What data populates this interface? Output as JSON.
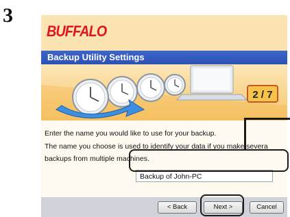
{
  "step_number": "3",
  "logo_text": "BUFFALO",
  "window_title": "Backup Utility Settings",
  "step_indicator": "2 / 7",
  "description": [
    "Enter the name you would like to use for your backup.",
    "The name you choose is used to identify your data if you make severa",
    "backups from multiple machines."
  ],
  "backup_name_value": "Backup of John-PC",
  "buttons": {
    "back": "< Back",
    "next": "Next >",
    "cancel": "Cancel"
  },
  "colors": {
    "brand_red": "#e0161e",
    "title_blue": "#2c52b4",
    "step_badge": "#f6c24a"
  }
}
